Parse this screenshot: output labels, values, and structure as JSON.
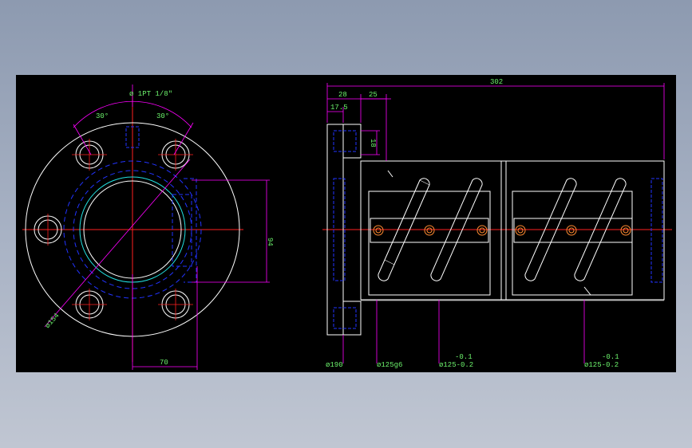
{
  "colors": {
    "background": "#000000",
    "outline": "#ffffff",
    "centerline": "#ff2020",
    "hidden": "#2233ff",
    "dimension": "#ff00ff",
    "dim_text": "#66ff66",
    "inner_ring": "#22e0e0"
  },
  "dimensions": {
    "thread": "ø 1PT 1/8\"",
    "angle_left": "30°",
    "angle_right": "30°",
    "height_94": "94",
    "bolt_circle": "ø154",
    "offset_70": "70",
    "total_302": "302",
    "w28": "28",
    "w25": "25",
    "w17_5": "17.5",
    "h18": "18",
    "d190": "ø190",
    "d125g6": "ø125g6",
    "d125_a": "ø125-0.2",
    "tol_a": "-0.1",
    "d125_b": "ø125-0.2",
    "tol_b": "-0.1"
  }
}
